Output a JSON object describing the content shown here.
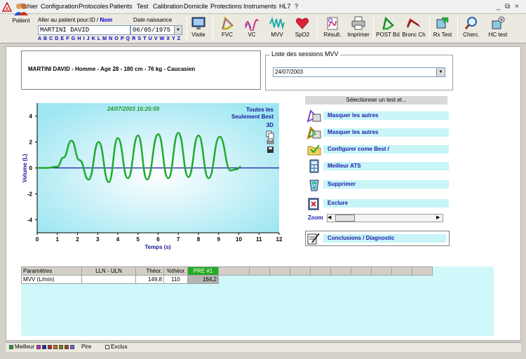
{
  "menu": {
    "items": [
      "Fichier",
      "Configuration",
      "Protocoles",
      "Patients",
      "Test",
      "Calibration",
      "Domicile",
      "Protections",
      "Instruments",
      "HL7",
      "?"
    ],
    "window_controls": [
      "_",
      "⧉",
      "×"
    ]
  },
  "toolbar": {
    "patient_label": "Patient",
    "search_label_prefix": "Aller au patient pour:ID",
    "search_label_sep": " / ",
    "search_label_nom": "Nom",
    "dob_label": "Date naissance",
    "patient_value": "MARTINI DAVID",
    "dob_value": "06/05/1975",
    "alphabet": "A B C D E F G H I J K L M N O P Q R S T U V W X Y Z",
    "buttons": {
      "visite": "Visite",
      "fvc": "FVC",
      "vc": "VC",
      "mvv": "MVV",
      "spo2": "SpO2",
      "result": "Résult.",
      "imprimer": "Imprimer",
      "post_bd": "POST Bd",
      "bronc_ch": "Bronc Ch",
      "rx_test": "Rx Test",
      "cherc": "Cherc.",
      "hc_test": "HC test"
    }
  },
  "patient_info": "MARTINI DAVID - Homme - Age 28 - 180 cm - 76 kg - Caucasien",
  "sessions": {
    "title": "Liste des sessions  MVV",
    "selected": "24/07/2003"
  },
  "chart_overlay": {
    "timestamp": "24/07/2003 16:26:59",
    "toggle_all": "Toutes les",
    "toggle_best": "Seulement Best",
    "toggle_3d": "3D"
  },
  "chart_data": {
    "type": "line",
    "xlabel": "Temps  (s)",
    "ylabel": "Volume  (L)",
    "xlim": [
      0,
      12
    ],
    "ylim": [
      -5,
      5
    ],
    "xticks": [
      0,
      1,
      2,
      3,
      4,
      5,
      6,
      7,
      8,
      9,
      10,
      11,
      12
    ],
    "yticks": [
      -4,
      -2,
      0,
      2,
      4
    ],
    "zero_line": 0,
    "series": [
      {
        "color": "#22aa33",
        "x": [
          0,
          0.5,
          1.0,
          1.3,
          1.7,
          2.1,
          2.55,
          3.05,
          3.55,
          4.0,
          4.5,
          5.0,
          5.45,
          6.0,
          6.5,
          7.0,
          7.5,
          8.0,
          8.5,
          9.05,
          9.6,
          9.9,
          10.1
        ],
        "y": [
          0,
          0,
          0.1,
          0.8,
          2.1,
          0.6,
          -0.9,
          2.0,
          -1.1,
          2.3,
          -0.8,
          2.5,
          -0.9,
          2.6,
          -0.8,
          2.7,
          -0.7,
          2.5,
          -0.8,
          2.4,
          -0.2,
          -0.1,
          0.1
        ]
      }
    ],
    "grid": false
  },
  "test_panel": {
    "header": "Sélectionner un test et...",
    "actions": [
      {
        "label": "Masquer les autres",
        "icon": "hide-others-icon"
      },
      {
        "label": "Masquer les autres",
        "icon": "hide-others-alt-icon"
      },
      {
        "label": "Configurer come  Best /",
        "icon": "folder-best-icon"
      },
      {
        "label": "Meilleur ATS",
        "icon": "calculator-icon"
      },
      {
        "label": "Supprimer",
        "icon": "recycle-bin-icon"
      },
      {
        "label": "Exclure",
        "icon": "exclude-icon"
      }
    ],
    "zoom_label": "Zoom",
    "conclusions_label": "Conclusions / Diagnostic"
  },
  "results_table": {
    "headers": [
      "Paramètres",
      "LLN - ULN",
      "Théor.",
      "%théor.",
      "PRE #1"
    ],
    "rows": [
      {
        "param": "MVV (L/min)",
        "lln_uln": "",
        "theor": "149,8",
        "pct": "110",
        "pre1": "164,2"
      }
    ]
  },
  "legend": {
    "best_label": "Meilleur",
    "worst_label": "Pire",
    "excluded_label": "Exclus",
    "colors": [
      "#22aa22",
      "#cc22cc",
      "#2222cc",
      "#cc2222",
      "#cc7700",
      "#888800",
      "#aa4400",
      "#6666ff"
    ]
  }
}
